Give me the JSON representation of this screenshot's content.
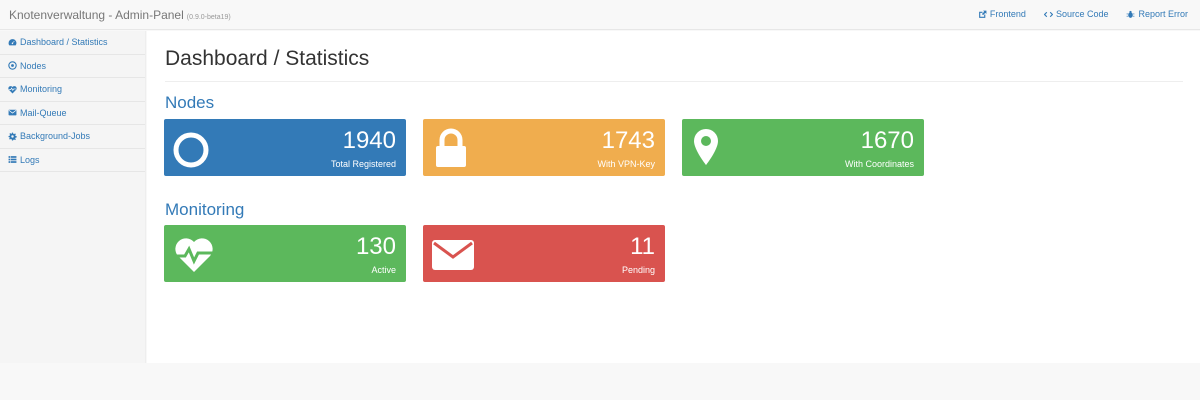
{
  "app": {
    "title": "Knotenverwaltung - Admin-Panel",
    "version": "(0.9.0-beta19)"
  },
  "nav": {
    "links": [
      {
        "label": "Frontend",
        "icon": "external-link-icon"
      },
      {
        "label": "Source Code",
        "icon": "code-icon"
      },
      {
        "label": "Report Error",
        "icon": "bug-icon"
      }
    ]
  },
  "sidebar": {
    "items": [
      {
        "label": "Dashboard / Statistics",
        "icon": "dashboard-icon"
      },
      {
        "label": "Nodes",
        "icon": "dot-circle-icon"
      },
      {
        "label": "Monitoring",
        "icon": "heartbeat-icon"
      },
      {
        "label": "Mail-Queue",
        "icon": "envelope-icon"
      },
      {
        "label": "Background-Jobs",
        "icon": "gear-icon"
      },
      {
        "label": "Logs",
        "icon": "list-icon"
      }
    ]
  },
  "main": {
    "page_title": "Dashboard / Statistics",
    "sections": [
      {
        "title": "Nodes",
        "cards": [
          {
            "value": "1940",
            "label": "Total Registered",
            "icon": "circle-icon",
            "color": "#337ab7"
          },
          {
            "value": "1743",
            "label": "With VPN-Key",
            "icon": "lock-icon",
            "color": "#f0ad4e"
          },
          {
            "value": "1670",
            "label": "With Coordinates",
            "icon": "map-marker-icon",
            "color": "#5cb85c"
          }
        ]
      },
      {
        "title": "Monitoring",
        "cards": [
          {
            "value": "130",
            "label": "Active",
            "icon": "heartbeat-icon",
            "color": "#5cb85c"
          },
          {
            "value": "11",
            "label": "Pending",
            "icon": "envelope-icon",
            "color": "#d9534f"
          }
        ]
      }
    ]
  }
}
